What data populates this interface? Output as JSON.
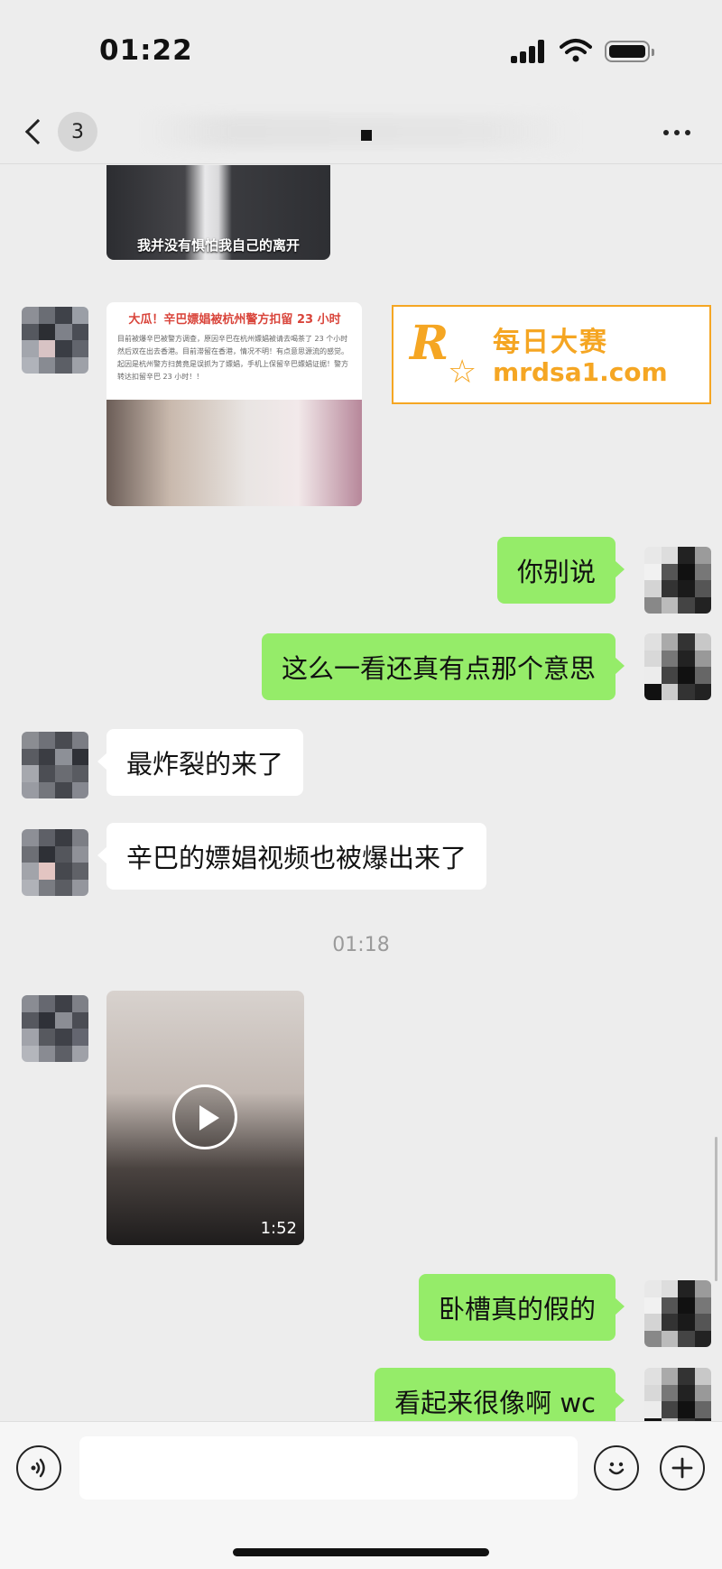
{
  "status_bar": {
    "time": "01:22"
  },
  "nav": {
    "unread_count": "3",
    "title_dot": "."
  },
  "top_image": {
    "caption": "我并没有惧怕我自己的离开"
  },
  "news_card": {
    "headline": "大瓜！辛巴嫖娼被杭州警方扣留 23 小时",
    "body": "目前被爆辛巴被警方调查，原因辛巴在杭州嫖娼被请去喝茶了 23 个小时然后双在出去香港。目前滞留在香港，情况不明！有点意思源流的感觉。起因是杭州警方扫黄竟是误抓为了嫖娼，手机上保留辛巴嫖娼证据！警方转达扣留辛巴 23 小时！！"
  },
  "watermark": {
    "logo": "R",
    "cn": "每日大赛",
    "url": "mrdsa1.com"
  },
  "messages": [
    {
      "side": "out",
      "text": "你别说"
    },
    {
      "side": "out",
      "text": "这么一看还真有点那个意思"
    },
    {
      "side": "in",
      "text": "最炸裂的来了"
    },
    {
      "side": "in",
      "text": "辛巴的嫖娼视频也被爆出来了"
    },
    {
      "side": "out",
      "text": "卧槽真的假的"
    },
    {
      "side": "out",
      "text": "看起来很像啊 wc"
    }
  ],
  "timestamp": "01:18",
  "video": {
    "duration": "1:52"
  },
  "input": {
    "placeholder": ""
  },
  "icons": {
    "voice": "voice-icon",
    "emoji": "emoji-icon",
    "plus": "plus-icon",
    "back": "chevron-left-icon",
    "more": "more-icon"
  },
  "colors": {
    "background": "#ededed",
    "bubble_out": "#95ec69",
    "bubble_in": "#ffffff",
    "watermark": "#f5a623"
  }
}
